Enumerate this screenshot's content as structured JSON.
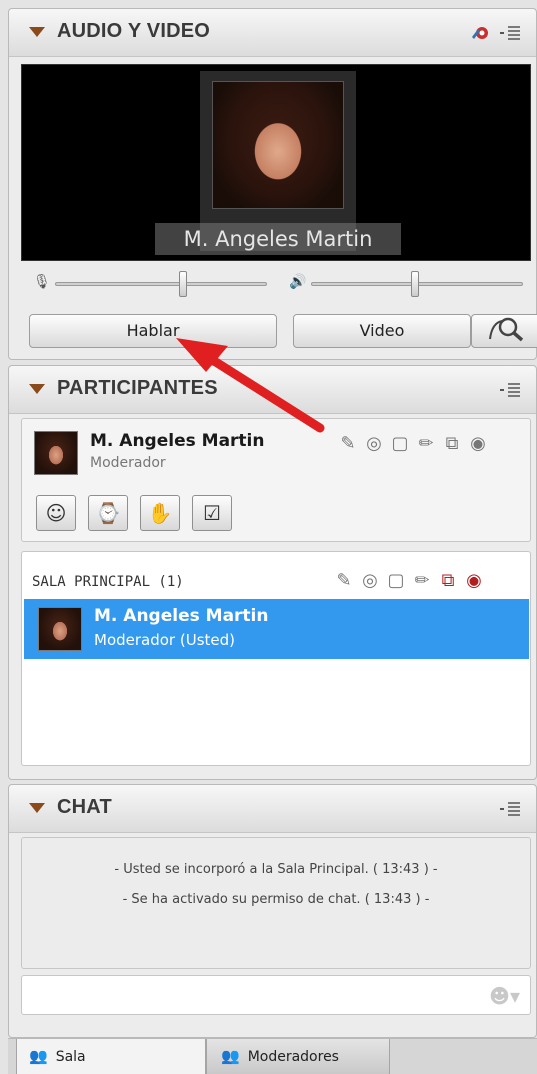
{
  "audio_video": {
    "title": "AUDIO Y VIDEO",
    "video_name": "M. Angeles Martin",
    "talk_button": "Hablar",
    "video_button": "Video"
  },
  "participants": {
    "title": "PARTICIPANTES",
    "me": {
      "name": "M. Angeles Martin",
      "role": "Moderador"
    },
    "room": {
      "title": "SALA PRINCIPAL (1)",
      "rows": [
        {
          "name": "M. Angeles Martin",
          "role": "Moderador (Usted)"
        }
      ]
    }
  },
  "chat": {
    "title": "CHAT",
    "messages": [
      "- Usted se incorporó a la Sala Principal. ( 13:43 ) -",
      "- Se ha activado su permiso de chat. ( 13:43 ) -"
    ]
  },
  "tabs": [
    {
      "label": "Sala"
    },
    {
      "label": "Moderadores"
    }
  ],
  "colors": {
    "selected_row": "#3399ee",
    "arrow": "#e02020"
  }
}
